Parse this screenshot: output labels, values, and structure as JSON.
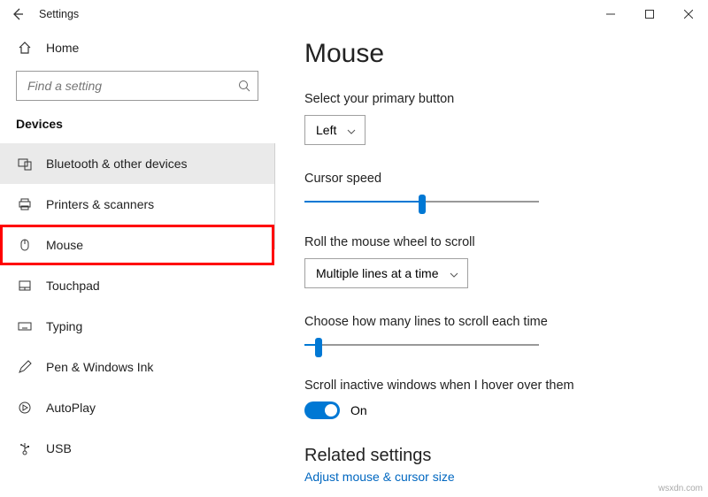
{
  "window": {
    "title": "Settings"
  },
  "sidebar": {
    "home": "Home",
    "search_placeholder": "Find a setting",
    "section": "Devices",
    "items": [
      {
        "label": "Bluetooth & other devices",
        "icon": "devices"
      },
      {
        "label": "Printers & scanners",
        "icon": "printer"
      },
      {
        "label": "Mouse",
        "icon": "mouse"
      },
      {
        "label": "Touchpad",
        "icon": "touchpad"
      },
      {
        "label": "Typing",
        "icon": "keyboard"
      },
      {
        "label": "Pen & Windows Ink",
        "icon": "pen"
      },
      {
        "label": "AutoPlay",
        "icon": "autoplay"
      },
      {
        "label": "USB",
        "icon": "usb"
      }
    ]
  },
  "main": {
    "heading": "Mouse",
    "primary_button": {
      "label": "Select your primary button",
      "value": "Left"
    },
    "cursor_speed": {
      "label": "Cursor speed",
      "value": 50
    },
    "wheel_mode": {
      "label": "Roll the mouse wheel to scroll",
      "value": "Multiple lines at a time"
    },
    "lines_scroll": {
      "label": "Choose how many lines to scroll each time",
      "value": 6
    },
    "scroll_inactive": {
      "label": "Scroll inactive windows when I hover over them",
      "state": "On"
    },
    "related_heading": "Related settings",
    "related_link": "Adjust mouse & cursor size"
  },
  "watermark": "wsxdn.com"
}
